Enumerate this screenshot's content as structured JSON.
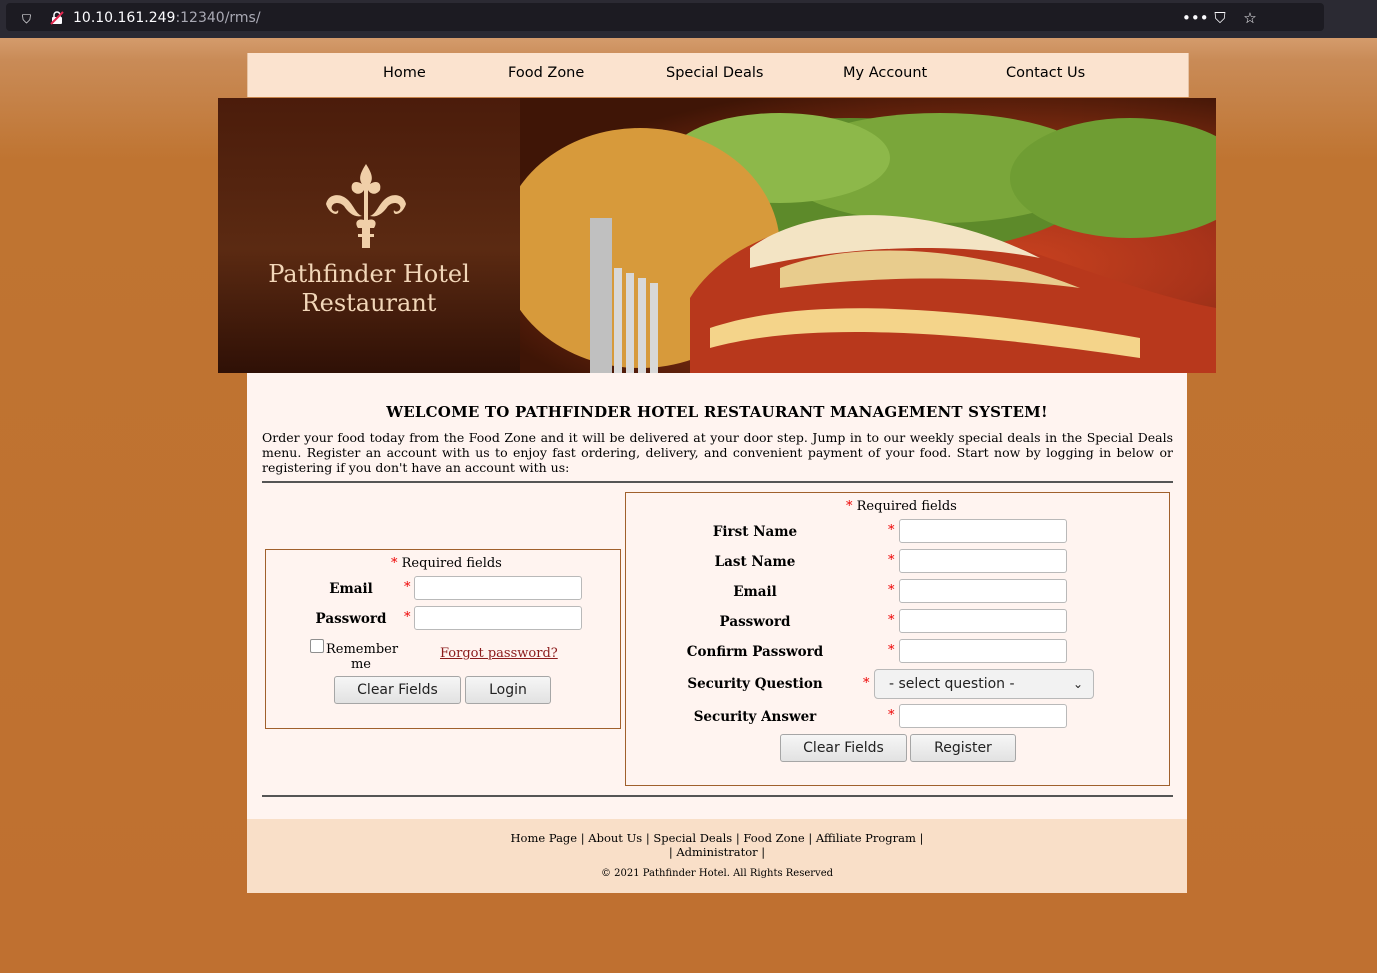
{
  "browser": {
    "url_host": "10.10.161.249",
    "url_rest": ":12340/rms/"
  },
  "nav": {
    "items": [
      "Home",
      "Food Zone",
      "Special Deals",
      "My Account",
      "Contact Us"
    ]
  },
  "banner": {
    "title_line1": "Pathfinder Hotel",
    "title_line2": "Restaurant"
  },
  "main": {
    "welcome": "WELCOME TO PATHFINDER HOTEL RESTAURANT MANAGEMENT SYSTEM!",
    "intro": "Order your food today from the Food Zone and it will be delivered at your door step. Jump in to our weekly special deals in the Special Deals menu. Register an account with us to enjoy fast ordering, delivery, and convenient payment of your food. Start now by logging in below or registering if you don't have an account with us:"
  },
  "login": {
    "required_note": "Required fields",
    "email_label": "Email",
    "password_label": "Password",
    "remember_line1": "Remember",
    "remember_line2": "me",
    "forgot": "Forgot password?",
    "clear_button": "Clear Fields",
    "login_button": "Login"
  },
  "register": {
    "required_note": "Required fields",
    "first_name_label": "First Name",
    "last_name_label": "Last Name",
    "email_label": "Email",
    "password_label": "Password",
    "confirm_password_label": "Confirm Password",
    "security_question_label": "Security Question",
    "security_question_value": "- select question -",
    "security_answer_label": "Security Answer",
    "clear_button": "Clear Fields",
    "register_button": "Register"
  },
  "footer": {
    "links": [
      "Home Page",
      "About Us",
      "Special Deals",
      "Food Zone",
      "Affiliate Program",
      "Administrator"
    ],
    "copyright": "© 2021 Pathfinder Hotel. All Rights Reserved"
  }
}
